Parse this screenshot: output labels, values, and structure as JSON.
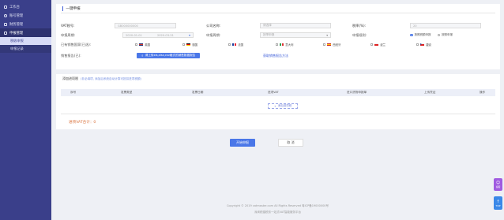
{
  "sidebar": {
    "items": [
      {
        "label": "工作台",
        "icon": "home-icon"
      },
      {
        "label": "账号管理",
        "icon": "user-icon"
      },
      {
        "label": "财务管理",
        "icon": "wallet-icon"
      },
      {
        "label": "申报管理",
        "icon": "declare-icon"
      }
    ],
    "sub_items": [
      {
        "label": "税收申报"
      },
      {
        "label": "申报记录"
      }
    ]
  },
  "form": {
    "section_title": "一键申报",
    "vat_label": "VAT税号:",
    "vat_value": "GB000000000",
    "company_label": "公司名称:",
    "company_value": "请选择",
    "rate_label": "税率(%):",
    "rate_value": "20",
    "period_label": "申报周期:",
    "period_start": "2020-01-01",
    "period_end": "2020-03-31",
    "frequency_label": "申报周期:",
    "frequency_value": "按季申报",
    "method_label": "申报规则:",
    "method_option1": "按照税额申报",
    "method_option2": "按照申报",
    "countries_label": "已有销售国家(已选):",
    "countries": [
      "英国",
      "德国",
      "法国",
      "意大利",
      "西班牙",
      "波兰",
      "捷克"
    ],
    "data_label": "销售报告(已):",
    "upload_button": "请上传xls,xlsx,csv格式的销售数据报告",
    "download_link": "获取销售报告方法"
  },
  "table": {
    "section_title": "添加进项税",
    "section_hint": "(非必填项, 添加后系统自动计算可抵扣进项税额)",
    "columns": [
      "序号",
      "发票类型",
      "发票日期",
      "进项VAT",
      "进口货物申报单",
      "上传凭证",
      "操作"
    ],
    "add_button": "添加进项税",
    "total_label": "进项VAT合计：0"
  },
  "actions": {
    "submit": "开始申报",
    "cancel": "取 消"
  },
  "footer": {
    "line1": "Copyright © 2019 vatmaster.com All Rights Reserved 粤ICP备19000000号",
    "line2": "深圳税猫税务一站式VAT智能服务平台"
  },
  "floats": {
    "service": "客服",
    "top": "TOP"
  },
  "colors": {
    "sidebar": "#3a3f8a",
    "accent": "#4a77e8",
    "total": "#d9703a"
  }
}
